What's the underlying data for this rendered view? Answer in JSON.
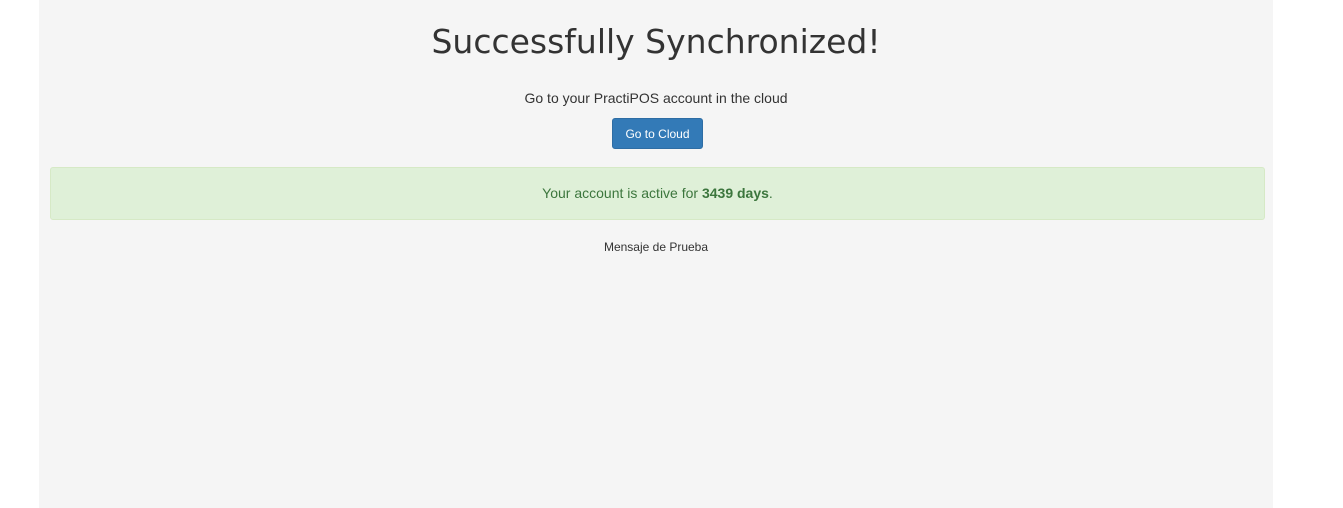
{
  "heading": "Successfully Synchronized!",
  "subtitle": "Go to your PractiPOS account in the cloud",
  "cloud_button_label": "Go to Cloud",
  "status": {
    "prefix": "Your account is active for",
    "days": "3439 days",
    "suffix": "."
  },
  "test_message": "Mensaje de Prueba",
  "colors": {
    "background": "#f5f5f5",
    "button": "#337ab7",
    "alert_background": "#dff0d8",
    "alert_text": "#3c763d"
  }
}
